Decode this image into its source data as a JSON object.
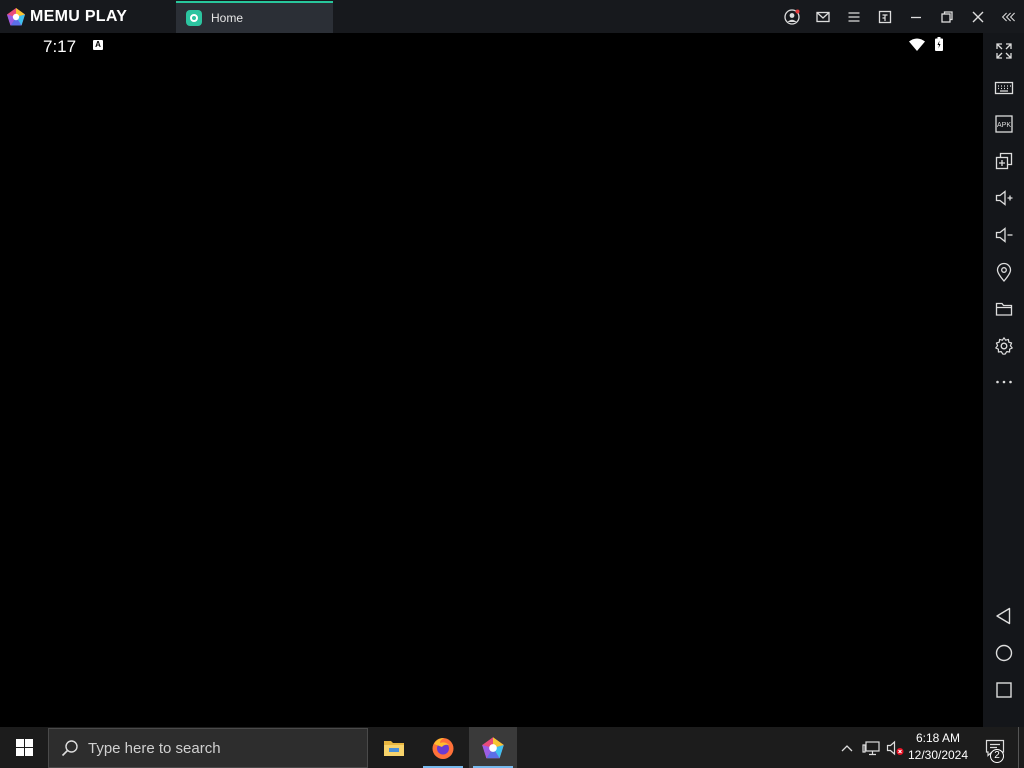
{
  "titlebar": {
    "app_name": "MEMU PLAY",
    "tab_label": "Home",
    "controls": [
      "user-icon",
      "mail-icon",
      "menu-icon",
      "screenshot-icon",
      "minimize-icon",
      "restore-icon",
      "close-icon",
      "collapse-sidebar-icon"
    ]
  },
  "android": {
    "status_time": "7:17",
    "status_badge": "A",
    "nav": [
      "back-icon",
      "home-icon",
      "recents-icon"
    ]
  },
  "sidebar": {
    "items": [
      "fullscreen-icon",
      "keyboard-icon",
      "apk-icon",
      "multi-instance-icon",
      "volume-up-icon",
      "volume-down-icon",
      "location-icon",
      "folder-icon",
      "settings-icon",
      "more-icon"
    ],
    "apk_label": "APK"
  },
  "taskbar": {
    "search_placeholder": "Type here to search",
    "time": "6:18 AM",
    "date": "12/30/2024",
    "notification_count": "2"
  },
  "colors": {
    "accent": "#28c79c",
    "titlebar": "#17191d",
    "taskbar": "#1c1c1c"
  }
}
